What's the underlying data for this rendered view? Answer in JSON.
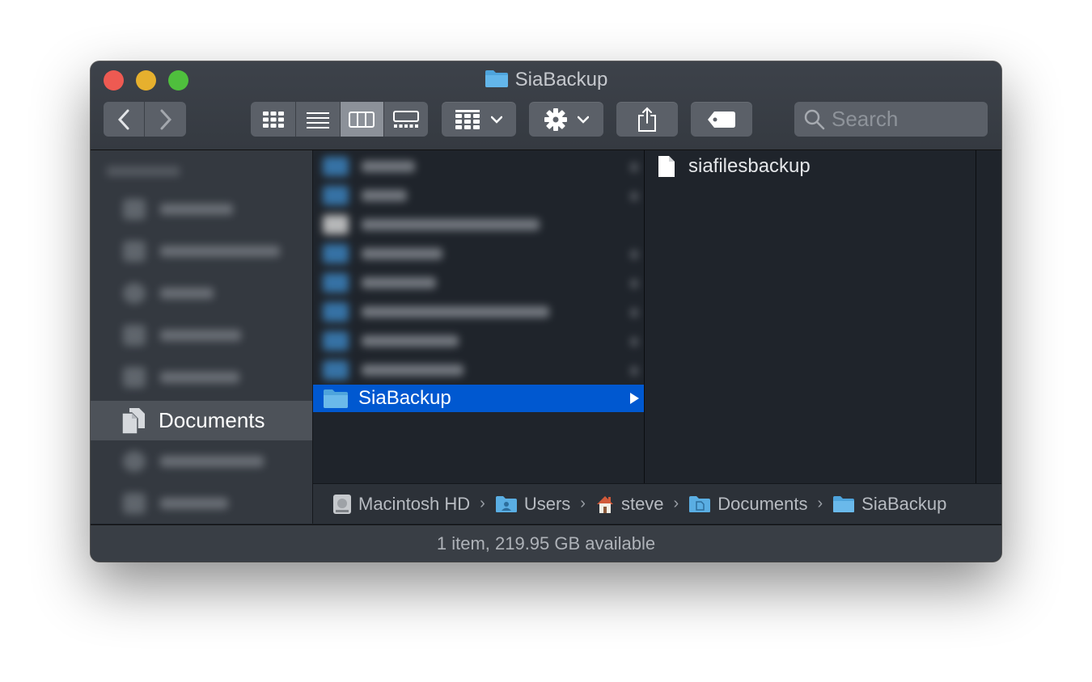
{
  "window": {
    "title": "SiaBackup"
  },
  "toolbar": {
    "back_icon": "chevron-left-icon",
    "forward_icon": "chevron-right-icon",
    "view_modes": [
      "icon-view",
      "list-view",
      "column-view",
      "gallery-view"
    ],
    "active_view": "column-view",
    "search_placeholder": "Search"
  },
  "sidebar": {
    "selected_item": {
      "label": "Documents",
      "icon": "documents-icon"
    }
  },
  "columns": {
    "selected_folder": {
      "label": "SiaBackup",
      "icon": "folder-icon"
    },
    "contents": [
      {
        "label": "siafilesbackup",
        "icon": "file-icon"
      }
    ]
  },
  "path_bar": {
    "items": [
      {
        "label": "Macintosh HD",
        "icon": "hard-drive-icon"
      },
      {
        "label": "Users",
        "icon": "users-folder-icon"
      },
      {
        "label": "steve",
        "icon": "home-icon"
      },
      {
        "label": "Documents",
        "icon": "documents-folder-icon"
      },
      {
        "label": "SiaBackup",
        "icon": "folder-icon"
      }
    ],
    "separator": "›"
  },
  "status": {
    "text": "1 item, 219.95 GB available"
  },
  "colors": {
    "selection_blue": "#0058d0",
    "folder_blue": "#5aaee3",
    "close": "#ee5a52",
    "minimize": "#e6b02e",
    "maximize": "#4fbf3d"
  }
}
